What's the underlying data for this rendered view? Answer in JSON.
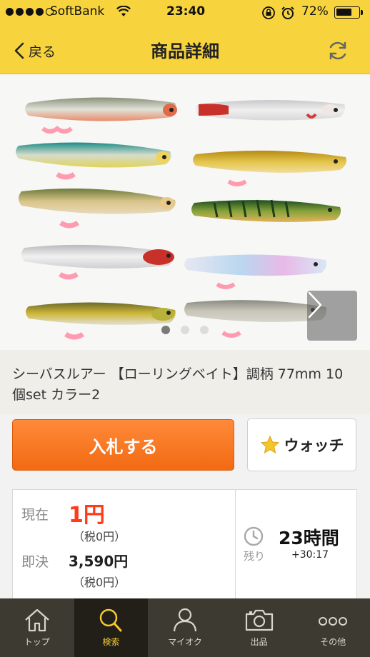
{
  "status": {
    "carrier": "SoftBank",
    "time": "23:40",
    "battery": "72%",
    "battery_level": 0.72
  },
  "nav": {
    "back_label": "戻る",
    "title": "商品詳細"
  },
  "gallery": {
    "page_count": 3,
    "current_page": 1
  },
  "product": {
    "title": "シーバスルアー 【ローリングベイト】調柄 77mm 10個set カラー2"
  },
  "actions": {
    "bid_label": "入札する",
    "watch_label": "ウォッチ"
  },
  "info": {
    "current_label": "現在",
    "current_price": "1円",
    "current_tax": "（税0円）",
    "buyout_label": "即決",
    "buyout_price": "3,590円",
    "buyout_tax": "（税0円）",
    "remaining_label": "残り",
    "remaining_time": "23時間",
    "remaining_extra": "+30:17"
  },
  "tabs": [
    {
      "label": "トップ",
      "icon": "home-icon"
    },
    {
      "label": "検索",
      "icon": "search-icon",
      "active": true
    },
    {
      "label": "マイオク",
      "icon": "person-icon"
    },
    {
      "label": "出品",
      "icon": "camera-icon"
    },
    {
      "label": "その他",
      "icon": "more-icon"
    }
  ],
  "colors": {
    "header": "#f7d33d",
    "bid_button": "#f26a12",
    "price": "#ff3b1a",
    "tabbar": "#3d3a32",
    "tab_active_text": "#f6c82c"
  }
}
